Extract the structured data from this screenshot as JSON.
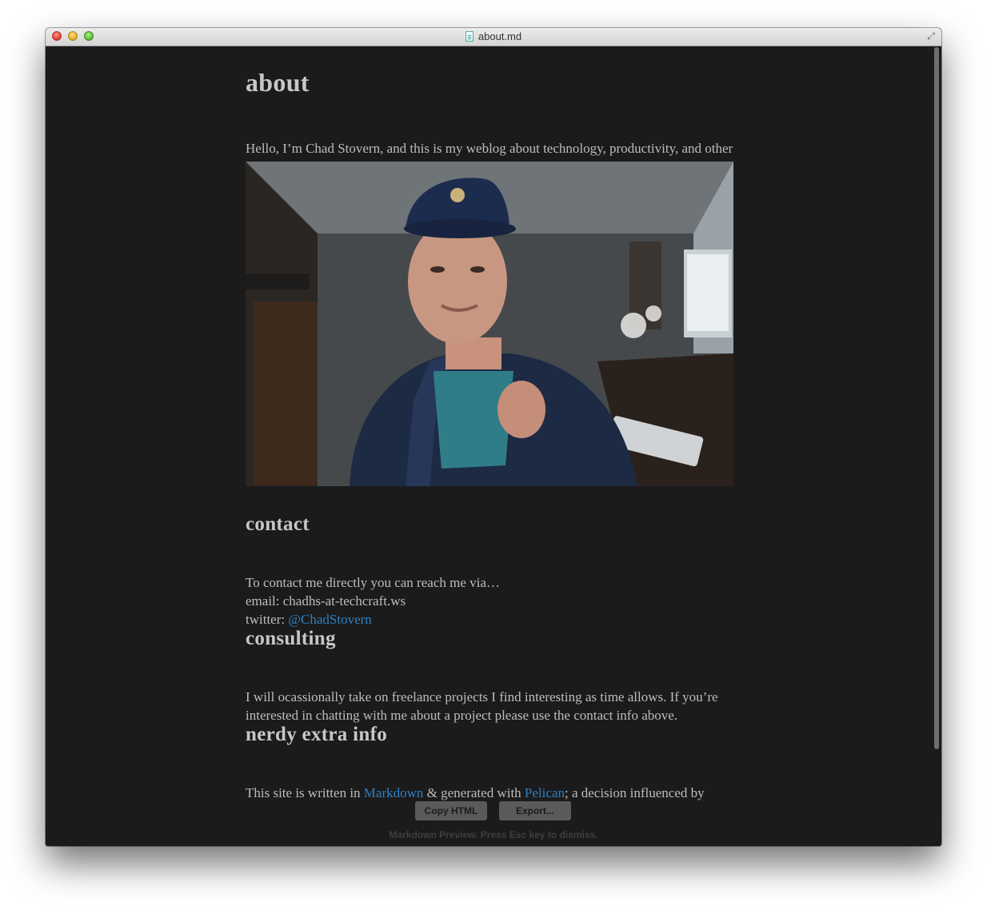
{
  "window": {
    "title": "about.md"
  },
  "about": {
    "heading": "about",
    "intro": "Hello, I’m Chad Stovern, and this is my weblog about technology, productivity, and other things related to “knowledge work”."
  },
  "contact": {
    "heading": "contact",
    "line1": "To contact me directly you can reach me via…",
    "email": "email: chadhs-at-techcraft.ws",
    "twitter_label": "twitter: ",
    "twitter_link": "@ChadStovern"
  },
  "consulting": {
    "heading": "consulting",
    "text": "I will ocassionally take on freelance projects I find interesting as time allows. If you’re interested in chatting with me about a project please use the contact info above."
  },
  "nerdy": {
    "heading": "nerdy extra info",
    "text_a": "This site is written in ",
    "link_markdown": "Markdown",
    "text_b": " & generated with ",
    "link_pelican": "Pelican",
    "text_c": "; a decision influenced by"
  },
  "preview": {
    "copy_html": "Copy HTML",
    "export": "Export...",
    "hint": "Markdown Preview. Press Esc key to dismiss."
  },
  "colors": {
    "background": "#1b1b1b",
    "text": "#bdbdbd",
    "link": "#2f7fc1"
  }
}
